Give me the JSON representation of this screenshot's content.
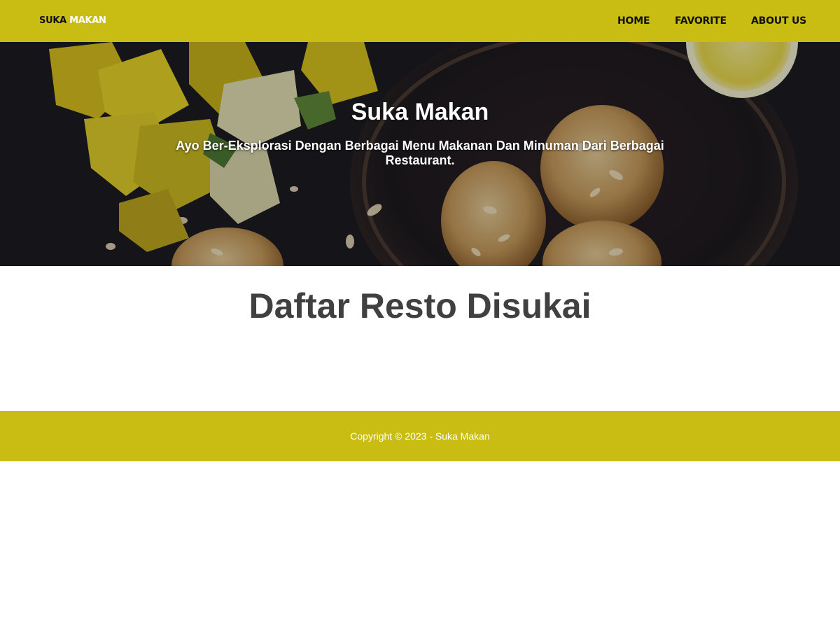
{
  "brand": {
    "part1": "SUKA ",
    "part2": "MAKAN"
  },
  "nav": {
    "home": "HOME",
    "favorite": "FAVORITE",
    "about": "ABOUT US"
  },
  "hero": {
    "title": "Suka Makan",
    "subtitle": "Ayo Ber-Eksplorasi Dengan Berbagai Menu Makanan Dan Minuman Dari Berbagai Restaurant."
  },
  "main": {
    "heading": "Daftar Resto Disukai"
  },
  "footer": {
    "copyright": "Copyright © 2023 - Suka Makan"
  },
  "colors": {
    "accent": "#c9bd13",
    "heading": "#404040",
    "hero_dark": "#1b1b20"
  }
}
